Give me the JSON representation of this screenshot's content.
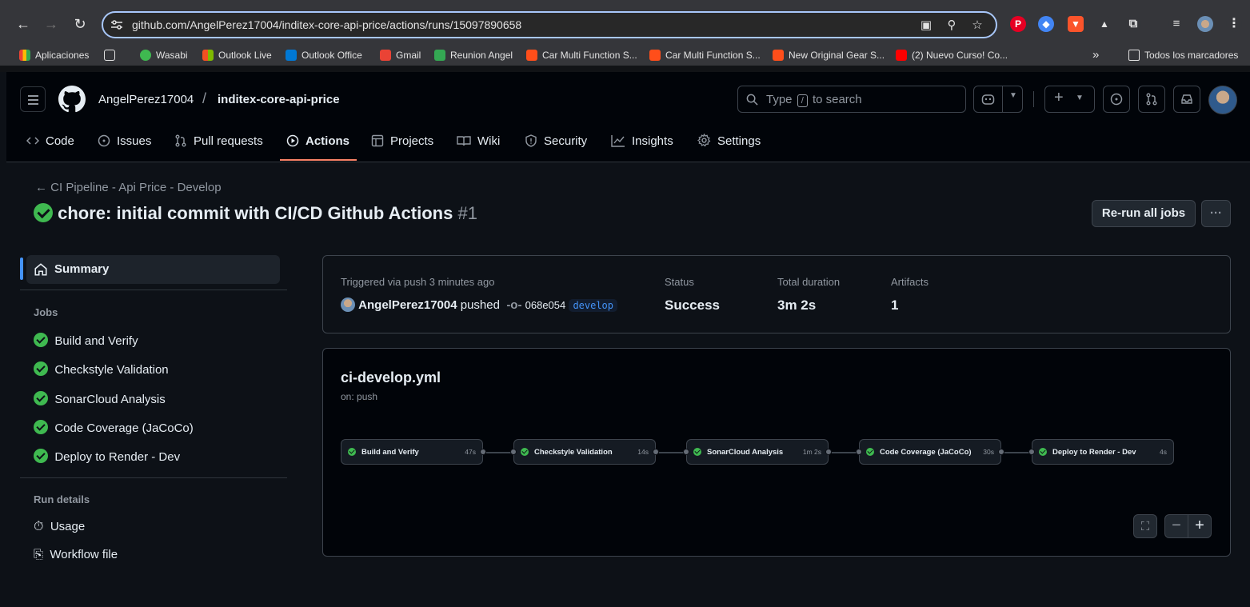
{
  "browser": {
    "url": "github.com/AngelPerez17004/inditex-core-api-price/actions/runs/15097890658",
    "bookmarks": [
      {
        "label": "Aplicaciones",
        "color": "#ea4335"
      },
      {
        "label": "Wasabi",
        "color": "#3fb950"
      },
      {
        "label": "Outlook Live",
        "color": "#f25022"
      },
      {
        "label": "Outlook Office",
        "color": "#0078d4"
      },
      {
        "label": "Gmail",
        "color": "#ea4335"
      },
      {
        "label": "Reunion Angel",
        "color": "#34a853"
      },
      {
        "label": "Car Multi Function S...",
        "color": "#ff4e1a"
      },
      {
        "label": "Car Multi Function S...",
        "color": "#ff4e1a"
      },
      {
        "label": "New Original Gear S...",
        "color": "#ff4e1a"
      },
      {
        "label": "(2) Nuevo Curso! Co...",
        "color": "#ff0000"
      }
    ],
    "all_bookmarks": "Todos los marcadores",
    "more": "»"
  },
  "header": {
    "owner": "AngelPerez17004",
    "separator": "/",
    "repo": "inditex-core-api-price",
    "search_before": "Type",
    "search_key": "/",
    "search_after": "to search"
  },
  "tabs": {
    "code": "Code",
    "issues": "Issues",
    "pulls": "Pull requests",
    "actions": "Actions",
    "projects": "Projects",
    "wiki": "Wiki",
    "security": "Security",
    "insights": "Insights",
    "settings": "Settings"
  },
  "run": {
    "workflow": "CI Pipeline - Api Price - Develop",
    "title": "chore: initial commit with CI/CD Github Actions",
    "number": "#1",
    "rerun": "Re-run all jobs",
    "more": "···"
  },
  "sidebar": {
    "summary": "Summary",
    "jobs_heading": "Jobs",
    "jobs": [
      "Build and Verify",
      "Checkstyle Validation",
      "SonarCloud Analysis",
      "Code Coverage (JaCoCo)",
      "Deploy to Render - Dev"
    ],
    "details_heading": "Run details",
    "usage": "Usage",
    "workflow_file": "Workflow file"
  },
  "summary": {
    "trigger_label": "Triggered via push 3 minutes ago",
    "actor": "AngelPerez17004",
    "action": "pushed",
    "commit": "068e054",
    "branch": "develop",
    "status_label": "Status",
    "status": "Success",
    "duration_label": "Total duration",
    "duration": "3m 2s",
    "artifacts_label": "Artifacts",
    "artifacts": "1"
  },
  "workflow": {
    "file": "ci-develop.yml",
    "on": "on: push",
    "jobs": [
      {
        "name": "Build and Verify",
        "duration": "47s"
      },
      {
        "name": "Checkstyle Validation",
        "duration": "14s"
      },
      {
        "name": "SonarCloud Analysis",
        "duration": "1m 2s"
      },
      {
        "name": "Code Coverage (JaCoCo)",
        "duration": "30s"
      },
      {
        "name": "Deploy to Render - Dev",
        "duration": "4s"
      }
    ],
    "zoom_out": "−",
    "zoom_in": "+"
  }
}
